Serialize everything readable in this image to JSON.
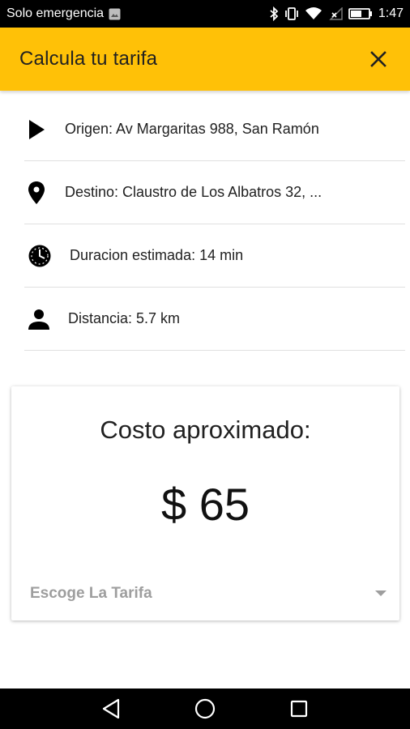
{
  "status_bar": {
    "carrier": "Solo emergencia",
    "time": "1:47",
    "icons": [
      "image-icon",
      "bluetooth-icon",
      "vibrate-icon",
      "wifi-icon",
      "no-signal-icon",
      "battery-icon"
    ]
  },
  "app_bar": {
    "title": "Calcula tu tarifa",
    "close_icon": "close-icon",
    "color": "#ffc107"
  },
  "info": {
    "origin": "Origen: Av Margaritas 988, San Ramón",
    "destination": "Destino: Claustro de Los Albatros 32, ...",
    "duration": "Duracion estimada: 14 min",
    "distance": "Distancia: 5.7 km"
  },
  "cost_card": {
    "title": "Costo aproximado:",
    "value": "$ 65",
    "fare_select_placeholder": "Escoge La Tarifa"
  },
  "nav_bar": {
    "icons": [
      "back-icon",
      "home-icon",
      "recents-icon"
    ]
  }
}
